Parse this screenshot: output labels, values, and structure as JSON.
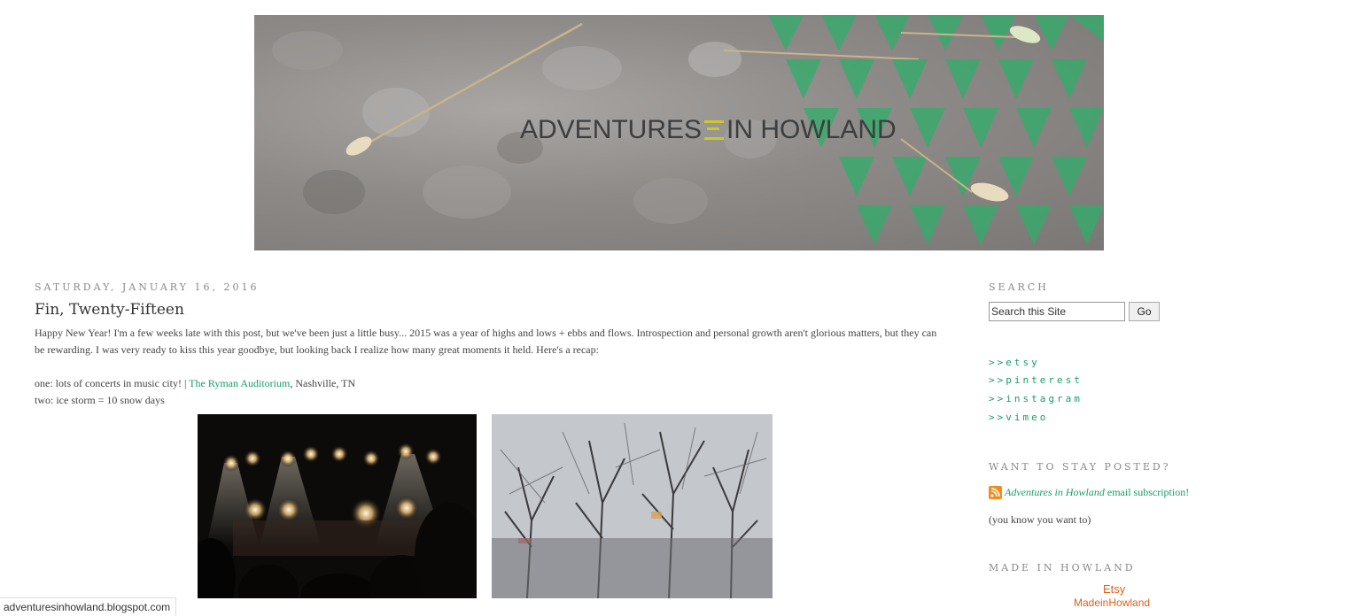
{
  "header": {
    "title_left": "ADVENTURES",
    "title_right": "IN HOWLAND",
    "colors": {
      "green": "#2fae6a",
      "mark": "#c9c92a"
    }
  },
  "post": {
    "date": "SATURDAY, JANUARY 16, 2016",
    "title": "Fin, Twenty-Fifteen",
    "intro": "Happy New Year! I'm a few weeks late with this post, but we've been just a little busy... 2015 was a year of highs and lows + ebbs and flows. Introspection and personal growth aren't glorious matters, but they can be rewarding. I was very ready to kiss this year goodbye, but looking back I realize how many great moments it held. Here's a recap:",
    "item1_prefix": "one: lots of concerts in music city! | ",
    "item1_link": "The Ryman Auditorium",
    "item1_suffix": ", Nashville, TN",
    "item2": "two: ice storm = 10 snow days"
  },
  "sidebar": {
    "search_heading": "SEARCH",
    "search_value": "Search this Site",
    "search_button": "Go",
    "links": [
      ">>etsy",
      ">>pinterest",
      ">>instagram",
      ">>vimeo"
    ],
    "stay_heading": "WANT TO STAY POSTED?",
    "subscribe_italic": "Adventures in Howland",
    "subscribe_rest": " email subscription!",
    "know_text": "(you know you want to)",
    "made_heading": "MADE IN HOWLAND",
    "etsy_line1": "Etsy",
    "etsy_line2": "MadeinHowland",
    "link_color": "#1a9c6b",
    "etsy_color": "#e0601c"
  },
  "status_bar": "adventuresinhowland.blogspot.com"
}
